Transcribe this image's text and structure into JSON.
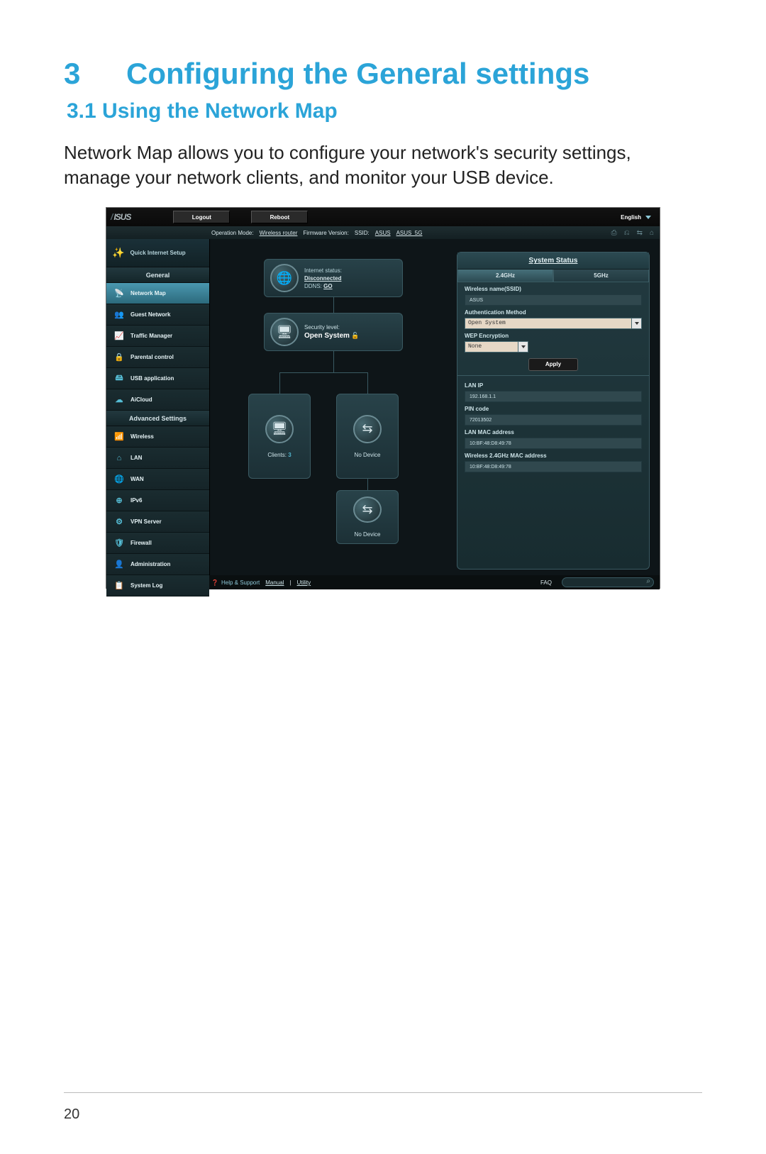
{
  "doc": {
    "chapter_num": "3",
    "chapter_title": "Configuring the General settings",
    "section": "3.1  Using the Network Map",
    "paragraph": "Network Map allows you to configure your network's security settings, manage your network clients, and monitor your USB device.",
    "page_number": "20"
  },
  "topbar": {
    "logout": "Logout",
    "reboot": "Reboot",
    "lang": "English"
  },
  "inforow": {
    "op_label": "Operation Mode:",
    "op_value": "Wireless router",
    "fw_label": "Firmware Version:",
    "ssid_label": "SSID:",
    "ssid1": "ASUS",
    "ssid2": "ASUS_5G"
  },
  "sidebar": {
    "qis": "Quick Internet Setup",
    "general_head": "General",
    "general": [
      {
        "label": "Network Map"
      },
      {
        "label": "Guest Network"
      },
      {
        "label": "Traffic Manager"
      },
      {
        "label": "Parental control"
      },
      {
        "label": "USB application"
      },
      {
        "label": "AiCloud"
      }
    ],
    "advanced_head": "Advanced Settings",
    "advanced": [
      {
        "label": "Wireless"
      },
      {
        "label": "LAN"
      },
      {
        "label": "WAN"
      },
      {
        "label": "IPv6"
      },
      {
        "label": "VPN Server"
      },
      {
        "label": "Firewall"
      },
      {
        "label": "Administration"
      },
      {
        "label": "System Log"
      }
    ]
  },
  "map": {
    "internet_label": "Internet status:",
    "internet_status": "Disconnected",
    "ddns_label": "DDNS:",
    "ddns_link": "GO",
    "sec_label": "Security level:",
    "sec_value": "Open System",
    "clients_label": "Clients:",
    "clients_count": "3",
    "usb_none": "No Device"
  },
  "status": {
    "title": "System Status",
    "tab24": "2.4GHz",
    "tab5": "5GHz",
    "wname_label": "Wireless name(SSID)",
    "wname_value": "ASUS",
    "auth_label": "Authentication Method",
    "auth_value": "Open System",
    "wep_label": "WEP Encryption",
    "wep_value": "None",
    "apply": "Apply",
    "lan_ip_label": "LAN IP",
    "lan_ip": "192.168.1.1",
    "pin_label": "PIN code",
    "pin": "72013502",
    "lan_mac_label": "LAN MAC address",
    "lan_mac": "10:BF:48:D8:49:78",
    "w24_mac_label": "Wireless 2.4GHz MAC address",
    "w24_mac": "10:BF:48:D8:49:78"
  },
  "footer": {
    "help": "Help & Support",
    "manual": "Manual",
    "utility": "Utility",
    "sep": " | ",
    "faq": "FAQ"
  }
}
